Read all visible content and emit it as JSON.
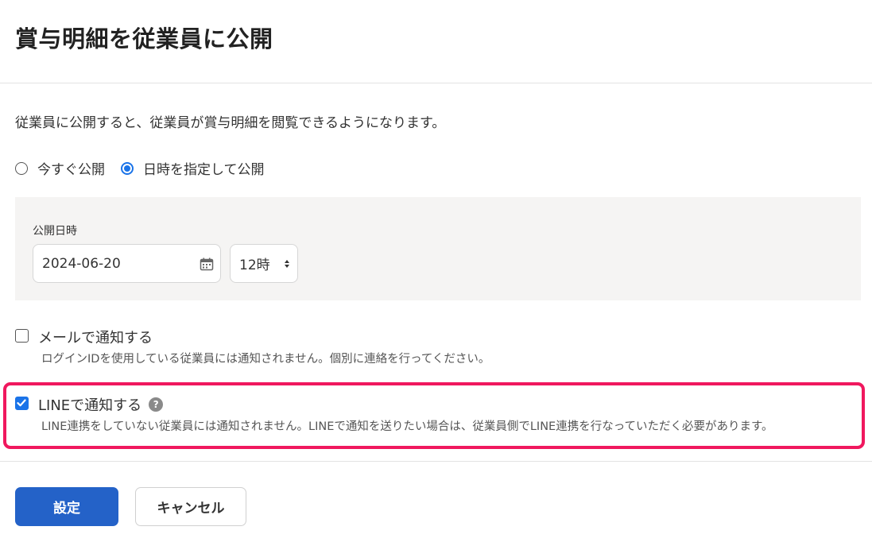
{
  "dialog": {
    "title": "賞与明細を従業員に公開",
    "description": "従業員に公開すると、従業員が賞与明細を閲覧できるようになります。"
  },
  "publish_mode": {
    "options": [
      {
        "label": "今すぐ公開",
        "checked": false
      },
      {
        "label": "日時を指定して公開",
        "checked": true
      }
    ]
  },
  "schedule": {
    "label": "公開日時",
    "date_value": "2024-06-20",
    "hour_value": "12時"
  },
  "notifications": {
    "email": {
      "label": "メールで通知する",
      "checked": false,
      "note": "ログインIDを使用している従業員には通知されません。個別に連絡を行ってください。"
    },
    "line": {
      "label": "LINEで通知する",
      "checked": true,
      "note": "LINE連携をしていない従業員には通知されません。LINEで通知を送りたい場合は、従業員側でLINE連携を行なっていただく必要があります。",
      "help_glyph": "?"
    }
  },
  "buttons": {
    "submit": "設定",
    "cancel": "キャンセル"
  },
  "colors": {
    "primary": "#2462c8",
    "accent_checked": "#1a73e8",
    "highlight": "#f0185e",
    "panel_bg": "#f5f4f3"
  },
  "icons": {
    "calendar": "calendar-icon",
    "select": "updown-chevron-icon",
    "help": "question-circle-icon",
    "check": "checkmark-icon"
  }
}
